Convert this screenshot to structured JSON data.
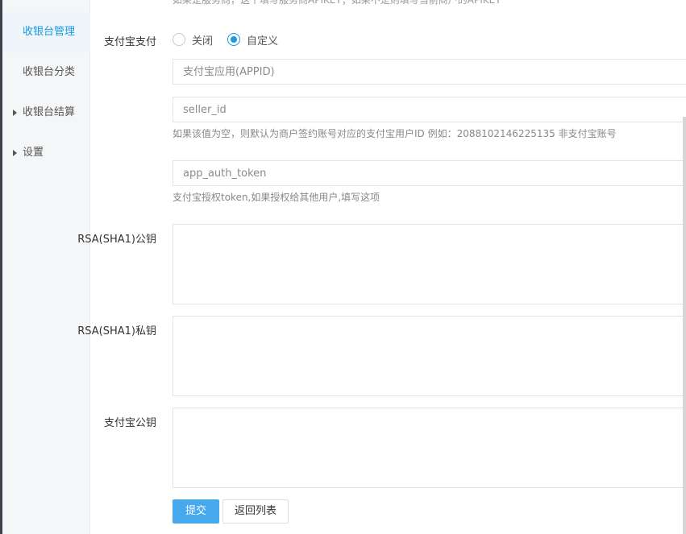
{
  "sidebar": {
    "items": [
      {
        "label": "收银台管理",
        "active": true,
        "expandable": false
      },
      {
        "label": "收银台分类",
        "active": false,
        "expandable": false
      },
      {
        "label": "收银台结算",
        "active": false,
        "expandable": true
      },
      {
        "label": "设置",
        "active": false,
        "expandable": true
      }
    ]
  },
  "form": {
    "top_hint": "如果是服务商，这个填写服务商APIKEY；如果不是则填写当前商户的APIKEY",
    "alipay_pay": {
      "label": "支付宝支付",
      "options": [
        {
          "label": "关闭",
          "checked": false
        },
        {
          "label": "自定义",
          "checked": true
        }
      ]
    },
    "appid": {
      "placeholder": "支付宝应用(APPID)",
      "value": ""
    },
    "seller_id": {
      "placeholder": "seller_id",
      "value": "",
      "help": "如果该值为空，则默认为商户签约账号对应的支付宝用户ID 例如：2088102146225135 非支付宝账号"
    },
    "app_auth_token": {
      "placeholder": "app_auth_token",
      "value": "",
      "help": "支付宝授权token,如果授权给其他用户,填写这项"
    },
    "rsa_public_key": {
      "label": "RSA(SHA1)公钥",
      "value": ""
    },
    "rsa_private_key": {
      "label": "RSA(SHA1)私钥",
      "value": ""
    },
    "alipay_public_key": {
      "label": "支付宝公钥",
      "value": ""
    },
    "submit_label": "提交",
    "back_label": "返回列表"
  },
  "colors": {
    "accent": "#1a9be0",
    "primary_button": "#46a9ee",
    "sidebar_bg": "#f5f6f7"
  }
}
